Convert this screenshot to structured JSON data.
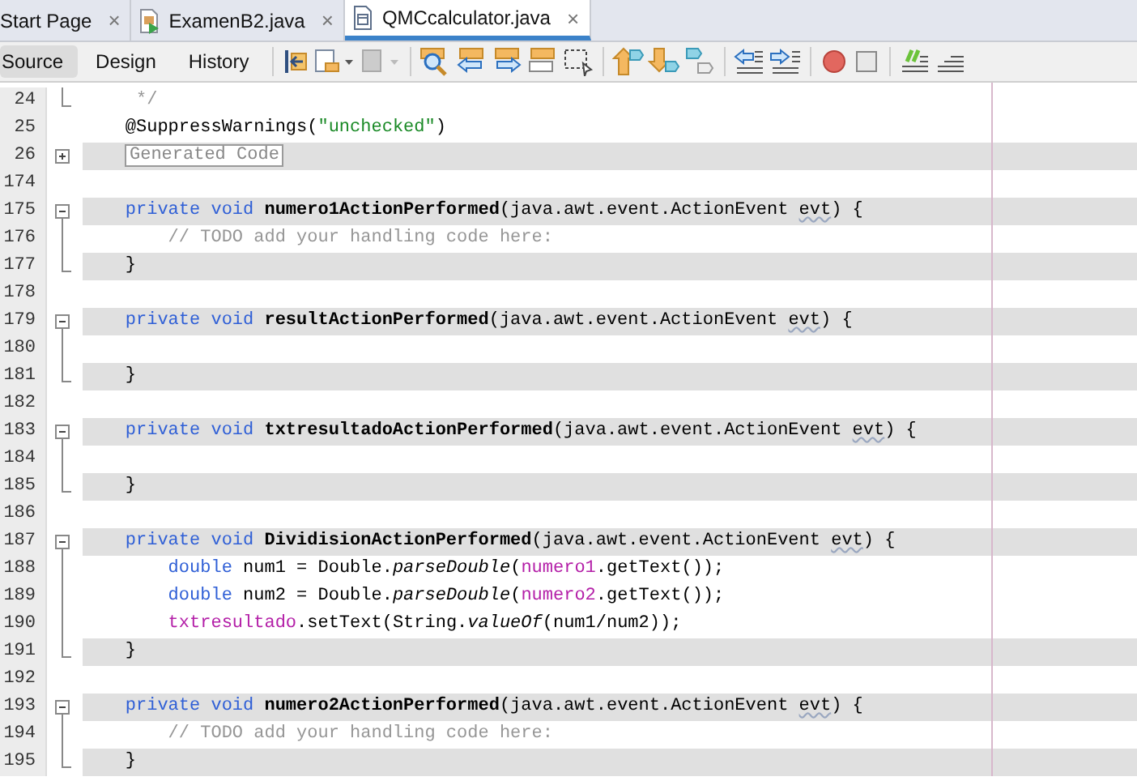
{
  "tabs": [
    {
      "label": "Start Page",
      "kind": "page",
      "selected": false,
      "close": "×"
    },
    {
      "label": "ExamenB2.java",
      "kind": "java-file",
      "selected": false,
      "close": "×"
    },
    {
      "label": "QMCcalculator.java",
      "kind": "form-file",
      "selected": true,
      "close": "×"
    }
  ],
  "view_tabs": [
    {
      "label": "Source",
      "selected": true
    },
    {
      "label": "Design",
      "selected": false
    },
    {
      "label": "History",
      "selected": false
    }
  ],
  "lines": [
    {
      "number": "24",
      "kind": "fold-end",
      "shaded": false,
      "segments": [
        {
          "kind": "comment",
          "text": "     */"
        }
      ]
    },
    {
      "number": "25",
      "kind": "plain",
      "shaded": false,
      "segments": [
        {
          "kind": "plain",
          "text": "    @SuppressWarnings("
        },
        {
          "kind": "string",
          "text": "\"unchecked\""
        },
        {
          "kind": "plain",
          "text": ")"
        }
      ]
    },
    {
      "number": "26",
      "kind": "fold-expand",
      "shaded": true,
      "segments": [
        {
          "kind": "collapsed",
          "text": "Generated Code"
        }
      ]
    },
    {
      "number": "174",
      "kind": "plain",
      "shaded": false
    },
    {
      "number": "175",
      "kind": "fold-start",
      "shaded": true,
      "segments": [
        {
          "kind": "keyword",
          "text": "    private void "
        },
        {
          "kind": "method",
          "text": "numero1ActionPerformed"
        },
        {
          "kind": "plain",
          "text": "(java.awt.event.ActionEvent "
        },
        {
          "kind": "warn",
          "text": "evt"
        },
        {
          "kind": "plain",
          "text": ") {"
        }
      ]
    },
    {
      "number": "176",
      "kind": "fold-body",
      "shaded": false,
      "segments": [
        {
          "kind": "comment",
          "text": "        // TODO add your handling code here:"
        }
      ]
    },
    {
      "number": "177",
      "kind": "fold-end",
      "shaded": true,
      "segments": [
        {
          "kind": "plain",
          "text": "    }"
        }
      ]
    },
    {
      "number": "178",
      "kind": "plain",
      "shaded": false
    },
    {
      "number": "179",
      "kind": "fold-start",
      "shaded": true,
      "segments": [
        {
          "kind": "keyword",
          "text": "    private void "
        },
        {
          "kind": "method",
          "text": "resultActionPerformed"
        },
        {
          "kind": "plain",
          "text": "(java.awt.event.ActionEvent "
        },
        {
          "kind": "warn",
          "text": "evt"
        },
        {
          "kind": "plain",
          "text": ") {"
        }
      ]
    },
    {
      "number": "180",
      "kind": "fold-body",
      "shaded": false
    },
    {
      "number": "181",
      "kind": "fold-end",
      "shaded": true,
      "segments": [
        {
          "kind": "plain",
          "text": "    }"
        }
      ]
    },
    {
      "number": "182",
      "kind": "plain",
      "shaded": false
    },
    {
      "number": "183",
      "kind": "fold-start",
      "shaded": true,
      "segments": [
        {
          "kind": "keyword",
          "text": "    private void "
        },
        {
          "kind": "method",
          "text": "txtresultadoActionPerformed"
        },
        {
          "kind": "plain",
          "text": "(java.awt.event.ActionEvent "
        },
        {
          "kind": "warn",
          "text": "evt"
        },
        {
          "kind": "plain",
          "text": ") {"
        }
      ]
    },
    {
      "number": "184",
      "kind": "fold-body",
      "shaded": false
    },
    {
      "number": "185",
      "kind": "fold-end",
      "shaded": true,
      "segments": [
        {
          "kind": "plain",
          "text": "    }"
        }
      ]
    },
    {
      "number": "186",
      "kind": "plain",
      "shaded": false
    },
    {
      "number": "187",
      "kind": "fold-start",
      "shaded": true,
      "segments": [
        {
          "kind": "keyword",
          "text": "    private void "
        },
        {
          "kind": "method",
          "text": "DividisionActionPerformed"
        },
        {
          "kind": "plain",
          "text": "(java.awt.event.ActionEvent "
        },
        {
          "kind": "warn",
          "text": "evt"
        },
        {
          "kind": "plain",
          "text": ") {"
        }
      ]
    },
    {
      "number": "188",
      "kind": "fold-body",
      "shaded": false,
      "segments": [
        {
          "kind": "keyword",
          "text": "        double "
        },
        {
          "kind": "plain",
          "text": "num1 = Double."
        },
        {
          "kind": "static",
          "text": "parseDouble"
        },
        {
          "kind": "plain",
          "text": "("
        },
        {
          "kind": "field",
          "text": "numero1"
        },
        {
          "kind": "plain",
          "text": ".getText());"
        }
      ]
    },
    {
      "number": "189",
      "kind": "fold-body",
      "shaded": false,
      "segments": [
        {
          "kind": "keyword",
          "text": "        double "
        },
        {
          "kind": "plain",
          "text": "num2 = Double."
        },
        {
          "kind": "static",
          "text": "parseDouble"
        },
        {
          "kind": "plain",
          "text": "("
        },
        {
          "kind": "field",
          "text": "numero2"
        },
        {
          "kind": "plain",
          "text": ".getText());"
        }
      ]
    },
    {
      "number": "190",
      "kind": "fold-body",
      "shaded": false,
      "segments": [
        {
          "kind": "field",
          "text": "        txtresultado"
        },
        {
          "kind": "plain",
          "text": ".setText(String."
        },
        {
          "kind": "static",
          "text": "valueOf"
        },
        {
          "kind": "plain",
          "text": "(num1/num2));"
        }
      ]
    },
    {
      "number": "191",
      "kind": "fold-end",
      "shaded": true,
      "segments": [
        {
          "kind": "plain",
          "text": "    }"
        }
      ]
    },
    {
      "number": "192",
      "kind": "plain",
      "shaded": false
    },
    {
      "number": "193",
      "kind": "fold-start",
      "shaded": true,
      "segments": [
        {
          "kind": "keyword",
          "text": "    private void "
        },
        {
          "kind": "method",
          "text": "numero2ActionPerformed"
        },
        {
          "kind": "plain",
          "text": "(java.awt.event.ActionEvent "
        },
        {
          "kind": "warn",
          "text": "evt"
        },
        {
          "kind": "plain",
          "text": ") {"
        }
      ]
    },
    {
      "number": "194",
      "kind": "fold-body",
      "shaded": false,
      "segments": [
        {
          "kind": "comment",
          "text": "        // TODO add your handling code here:"
        }
      ]
    },
    {
      "number": "195",
      "kind": "fold-end",
      "shaded": true,
      "segments": [
        {
          "kind": "plain",
          "text": "    }"
        }
      ]
    }
  ]
}
